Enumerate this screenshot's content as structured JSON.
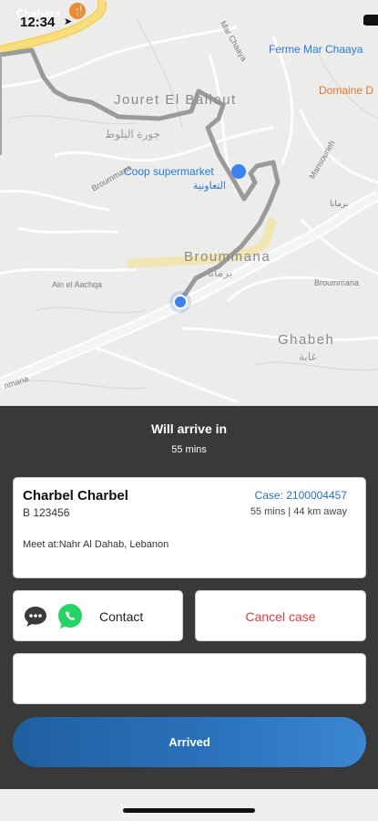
{
  "status_bar": {
    "time": "12:34",
    "location_arrow": "location-arrow-icon"
  },
  "map": {
    "labels": {
      "chahara": "Chahara",
      "jouret_el_ballout": "Jouret El Ballout",
      "jouret_el_ballout_ar": "جورة البلوط",
      "coop": "Coop supermarket",
      "coop_ar": "التعاونية",
      "broummana": "Broummana",
      "broummana_ar": "برمانا",
      "ain_el_aachqa": "Ain el Aachqa",
      "ghabeh": "Ghabeh",
      "ghabeh_ar": "غابة",
      "ferme_mar_chaaya": "Ferme Mar Chaaya",
      "domaine": "Domaine D",
      "broummana_road": "Broummana",
      "broummana_road2": "Broummana",
      "road_ar": "برمانا",
      "road_left": "nmana",
      "mar_chaaya": "Mar Chaaya",
      "mansourieh": "Mansourieh"
    },
    "colors": {
      "route": "#9a9a9a",
      "location_dot": "#3b82f0",
      "highway": "#f7dd7e"
    }
  },
  "sheet": {
    "eta_title": "Will arrive in",
    "eta_value": "55 mins",
    "driver": {
      "name": "Charbel Charbel",
      "plate": "B 123456",
      "case": "Case: 2100004457",
      "eta_distance": "55 mins | 44 km away",
      "meet": "Meet at:Nahr Al Dahab, Lebanon"
    },
    "contact_label": "Contact",
    "cancel_label": "Cancel case",
    "arrived_label": "Arrived",
    "colors": {
      "accent": "#2c73bd",
      "cancel": "#e83a3a",
      "whatsapp": "#25d366"
    }
  }
}
